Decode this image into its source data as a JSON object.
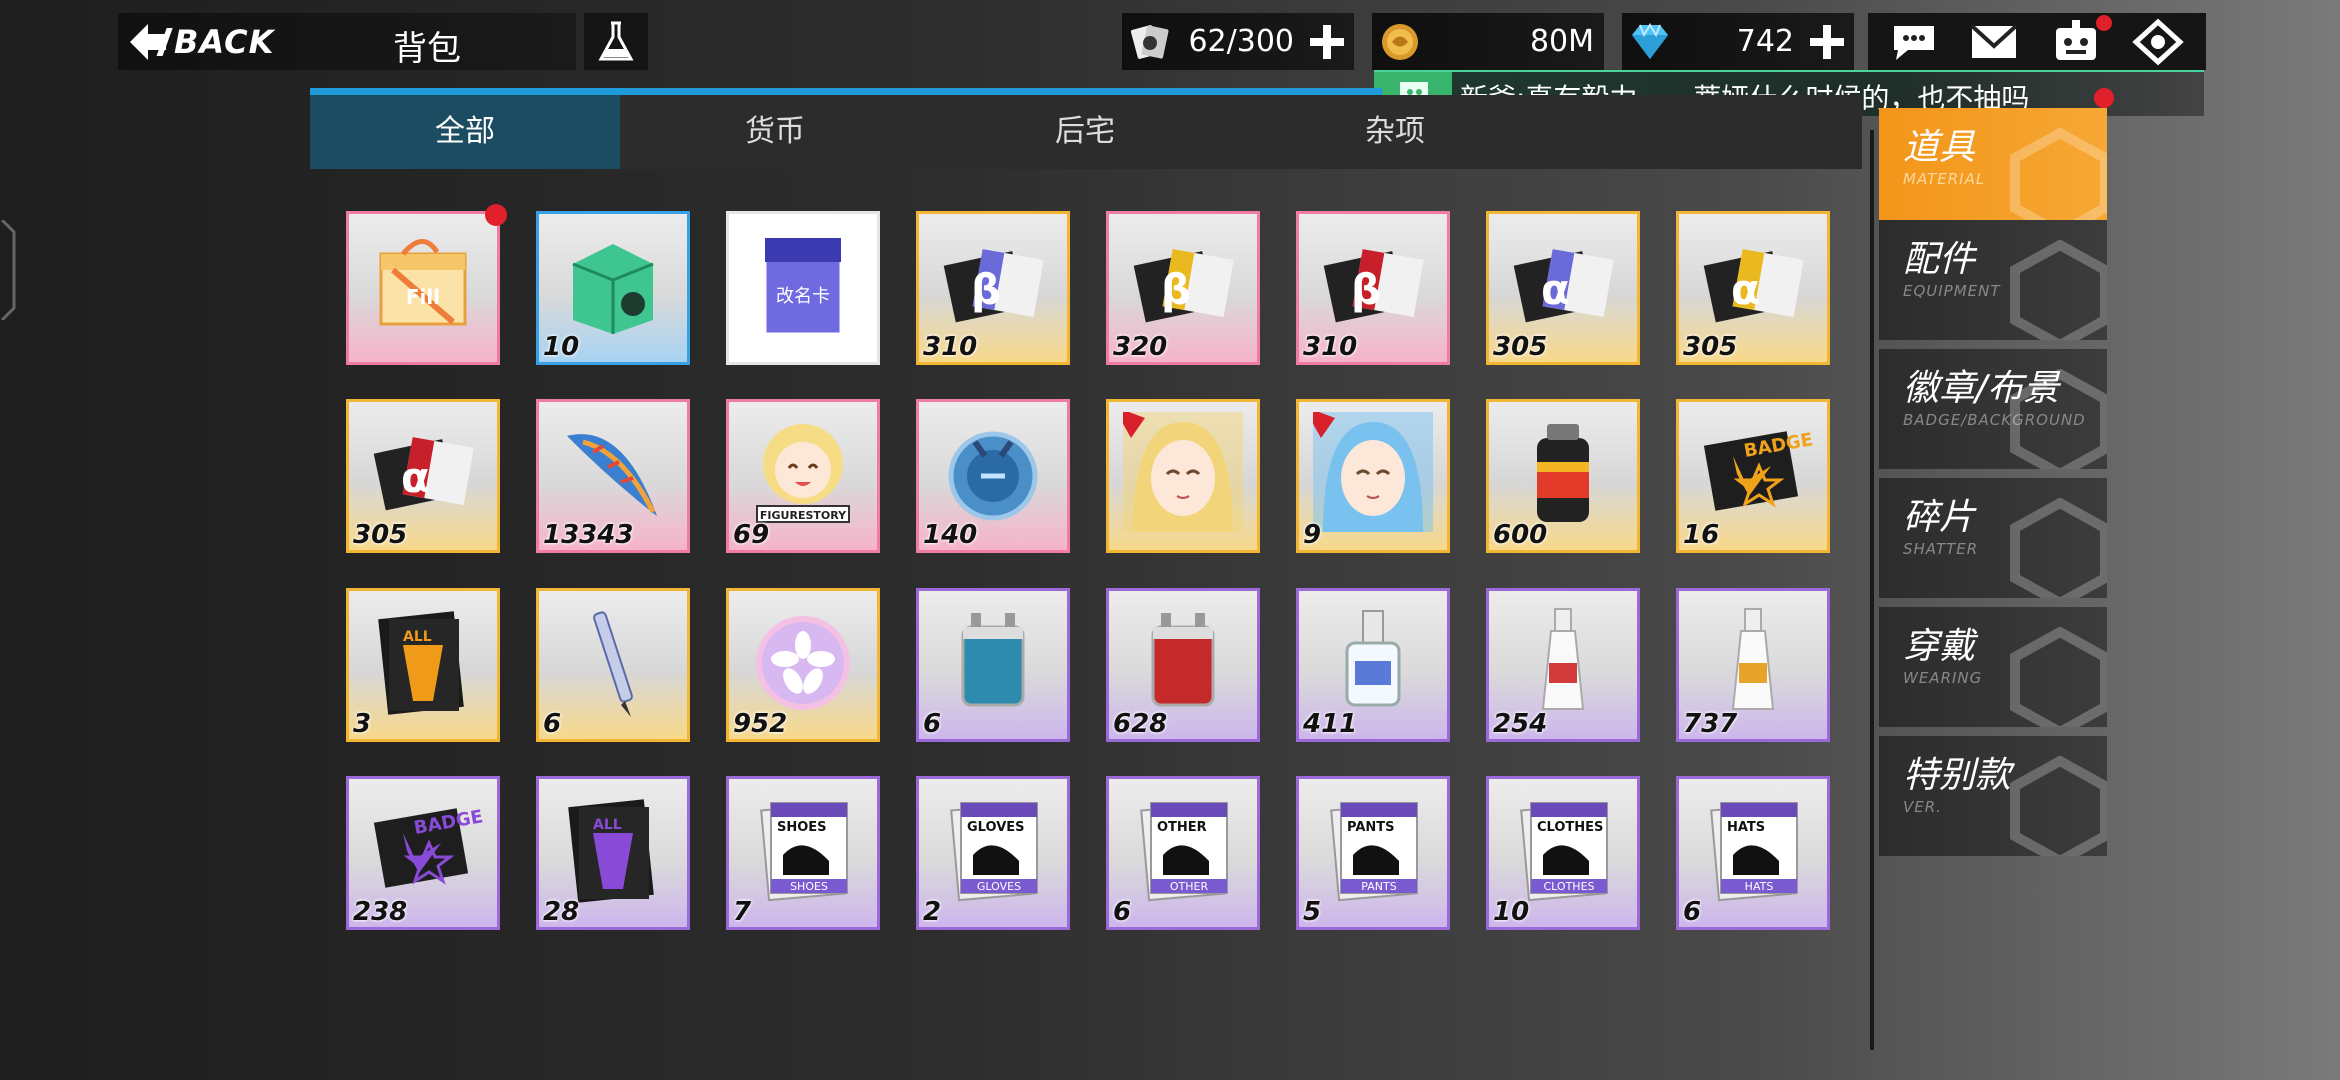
{
  "header": {
    "back_label": "BACK",
    "page_title": "背包",
    "capacity": "62/300",
    "gold": "80M",
    "diamonds": "742"
  },
  "ticker": {
    "message": "新爺:真有毅力。。。蒂娅什么时候的，也不抽吗"
  },
  "tabs": [
    {
      "label": "全部"
    },
    {
      "label": "货币"
    },
    {
      "label": "后宅"
    },
    {
      "label": "杂项"
    }
  ],
  "categories": [
    {
      "cn": "道具",
      "en": "MATERIAL"
    },
    {
      "cn": "配件",
      "en": "EQUIPMENT"
    },
    {
      "cn": "徽章/布景",
      "en": "BADGE/BACKGROUND"
    },
    {
      "cn": "碎片",
      "en": "SHATTER"
    },
    {
      "cn": "穿戴",
      "en": "WEARING"
    },
    {
      "cn": "特别款",
      "en": "VER."
    }
  ],
  "items": [
    {
      "name": "gift-box",
      "qty": "",
      "rarity": "pink",
      "icon": "gift-box-icon",
      "text": "Fill"
    },
    {
      "name": "green-gift-box",
      "qty": "10",
      "rarity": "blue",
      "icon": "green-box-icon",
      "text": ""
    },
    {
      "name": "rename-card",
      "qty": "",
      "rarity": "white",
      "icon": "rename-card-icon",
      "text": "改名卡"
    },
    {
      "name": "ticket-b-blue",
      "qty": "310",
      "rarity": "gold",
      "icon": "ticket-icon",
      "text": "β"
    },
    {
      "name": "ticket-b-gold",
      "qty": "320",
      "rarity": "pink",
      "icon": "ticket-icon",
      "text": "β"
    },
    {
      "name": "ticket-b-red",
      "qty": "310",
      "rarity": "pink",
      "icon": "ticket-icon",
      "text": "β"
    },
    {
      "name": "ticket-a-blue",
      "qty": "305",
      "rarity": "gold",
      "icon": "ticket-icon",
      "text": "α"
    },
    {
      "name": "ticket-a-gold",
      "qty": "305",
      "rarity": "gold",
      "icon": "ticket-icon",
      "text": "α"
    },
    {
      "name": "ticket-a-red",
      "qty": "305",
      "rarity": "gold",
      "icon": "ticket-icon",
      "text": "α"
    },
    {
      "name": "feather",
      "qty": "13343",
      "rarity": "pink",
      "icon": "feather-icon",
      "text": ""
    },
    {
      "name": "figurestory-badge",
      "qty": "69",
      "rarity": "pink",
      "icon": "chibi-icon",
      "text": "FIGURESTORY"
    },
    {
      "name": "blue-orb",
      "qty": "140",
      "rarity": "pink",
      "icon": "orb-icon",
      "text": ""
    },
    {
      "name": "portrait-blonde",
      "qty": "",
      "rarity": "gold",
      "icon": "portrait-icon",
      "text": ""
    },
    {
      "name": "portrait-blue-hair",
      "qty": "9",
      "rarity": "gold",
      "icon": "portrait-icon",
      "text": ""
    },
    {
      "name": "spray-can",
      "qty": "600",
      "rarity": "gold",
      "icon": "spray-can-icon",
      "text": ""
    },
    {
      "name": "badge-scroll-gold",
      "qty": "16",
      "rarity": "gold",
      "icon": "scroll-icon",
      "text": "BADGE"
    },
    {
      "name": "strengthen-book-gold",
      "qty": "3",
      "rarity": "gold",
      "icon": "book-icon",
      "text": "ALL"
    },
    {
      "name": "pen",
      "qty": "6",
      "rarity": "gold",
      "icon": "pen-icon",
      "text": ""
    },
    {
      "name": "sakura-orb",
      "qty": "952",
      "rarity": "gold",
      "icon": "sakura-orb-icon",
      "text": ""
    },
    {
      "name": "blue-battery",
      "qty": "6",
      "rarity": "purple",
      "icon": "battery-icon",
      "text": ""
    },
    {
      "name": "red-battery",
      "qty": "628",
      "rarity": "purple",
      "icon": "battery-icon",
      "text": ""
    },
    {
      "name": "nail-polish",
      "qty": "411",
      "rarity": "purple",
      "icon": "bottle-icon",
      "text": ""
    },
    {
      "name": "glue-tube-blue",
      "qty": "254",
      "rarity": "purple",
      "icon": "tube-icon",
      "text": ""
    },
    {
      "name": "glue-tube-gold",
      "qty": "737",
      "rarity": "purple",
      "icon": "tube-icon",
      "text": ""
    },
    {
      "name": "badge-scroll-purple",
      "qty": "238",
      "rarity": "purple",
      "icon": "scroll-icon",
      "text": "BADGE"
    },
    {
      "name": "strengthen-book-purple",
      "qty": "28",
      "rarity": "purple",
      "icon": "book-icon",
      "text": "ALL"
    },
    {
      "name": "manual-shoes",
      "qty": "7",
      "rarity": "purple",
      "icon": "manual-icon",
      "text": "SHOES"
    },
    {
      "name": "manual-gloves",
      "qty": "2",
      "rarity": "purple",
      "icon": "manual-icon",
      "text": "GLOVES"
    },
    {
      "name": "manual-other",
      "qty": "6",
      "rarity": "purple",
      "icon": "manual-icon",
      "text": "OTHER"
    },
    {
      "name": "manual-pants",
      "qty": "5",
      "rarity": "purple",
      "icon": "manual-icon",
      "text": "PANTS"
    },
    {
      "name": "manual-clothes",
      "qty": "10",
      "rarity": "purple",
      "icon": "manual-icon",
      "text": "CLOTHES"
    },
    {
      "name": "manual-hats",
      "qty": "6",
      "rarity": "purple",
      "icon": "manual-icon",
      "text": "HATS"
    }
  ]
}
